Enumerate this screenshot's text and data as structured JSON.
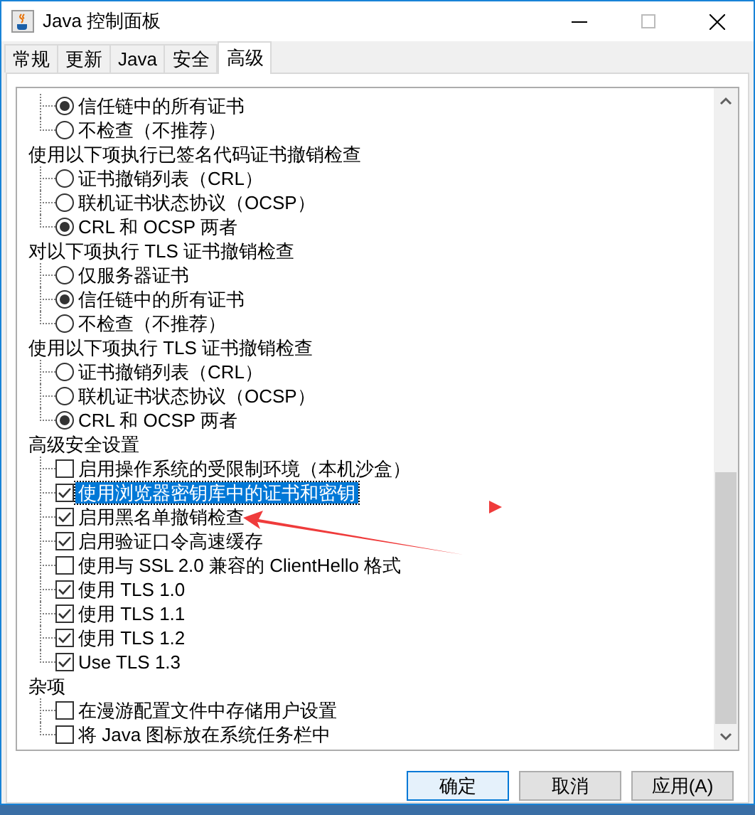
{
  "window": {
    "title": "Java 控制面板"
  },
  "tabs": [
    {
      "label": "常规",
      "selected": false
    },
    {
      "label": "更新",
      "selected": false
    },
    {
      "label": "Java",
      "selected": false
    },
    {
      "label": "安全",
      "selected": false
    },
    {
      "label": "高级",
      "selected": true
    }
  ],
  "sections": [
    {
      "options": [
        {
          "kind": "radio",
          "label": "信任链中的所有证书",
          "checked": true,
          "selected": false
        },
        {
          "kind": "radio",
          "label": "不检查（不推荐）",
          "checked": false,
          "selected": false
        }
      ]
    },
    {
      "title": "使用以下项执行已签名代码证书撤销检查",
      "options": [
        {
          "kind": "radio",
          "label": "证书撤销列表（CRL）",
          "checked": false,
          "selected": false
        },
        {
          "kind": "radio",
          "label": "联机证书状态协议（OCSP）",
          "checked": false,
          "selected": false
        },
        {
          "kind": "radio",
          "label": "CRL 和 OCSP 两者",
          "checked": true,
          "selected": false
        }
      ]
    },
    {
      "title": "对以下项执行 TLS 证书撤销检查",
      "options": [
        {
          "kind": "radio",
          "label": "仅服务器证书",
          "checked": false,
          "selected": false
        },
        {
          "kind": "radio",
          "label": "信任链中的所有证书",
          "checked": true,
          "selected": false
        },
        {
          "kind": "radio",
          "label": "不检查（不推荐）",
          "checked": false,
          "selected": false
        }
      ]
    },
    {
      "title": "使用以下项执行 TLS 证书撤销检查",
      "options": [
        {
          "kind": "radio",
          "label": "证书撤销列表（CRL）",
          "checked": false,
          "selected": false
        },
        {
          "kind": "radio",
          "label": "联机证书状态协议（OCSP）",
          "checked": false,
          "selected": false
        },
        {
          "kind": "radio",
          "label": "CRL 和 OCSP 两者",
          "checked": true,
          "selected": false
        }
      ]
    },
    {
      "title": "高级安全设置",
      "options": [
        {
          "kind": "checkbox",
          "label": "启用操作系统的受限制环境（本机沙盒）",
          "checked": false,
          "selected": false
        },
        {
          "kind": "checkbox",
          "label": "使用浏览器密钥库中的证书和密钥",
          "checked": true,
          "selected": true
        },
        {
          "kind": "checkbox",
          "label": "启用黑名单撤销检查",
          "checked": true,
          "selected": false
        },
        {
          "kind": "checkbox",
          "label": "启用验证口令高速缓存",
          "checked": true,
          "selected": false
        },
        {
          "kind": "checkbox",
          "label": "使用与 SSL 2.0 兼容的 ClientHello 格式",
          "checked": false,
          "selected": false
        },
        {
          "kind": "checkbox",
          "label": "使用 TLS 1.0",
          "checked": true,
          "selected": false
        },
        {
          "kind": "checkbox",
          "label": "使用 TLS 1.1",
          "checked": true,
          "selected": false
        },
        {
          "kind": "checkbox",
          "label": "使用 TLS 1.2",
          "checked": true,
          "selected": false
        },
        {
          "kind": "checkbox",
          "label": "Use TLS 1.3",
          "checked": true,
          "selected": false
        }
      ]
    },
    {
      "title": "杂项",
      "options": [
        {
          "kind": "checkbox",
          "label": "在漫游配置文件中存储用户设置",
          "checked": false,
          "selected": false
        },
        {
          "kind": "checkbox",
          "label": "将 Java 图标放在系统任务栏中",
          "checked": false,
          "selected": false
        }
      ]
    }
  ],
  "buttons": [
    {
      "label": "确定",
      "default": true
    },
    {
      "label": "取消",
      "default": false
    },
    {
      "label": "应用(A)",
      "default": false
    }
  ]
}
